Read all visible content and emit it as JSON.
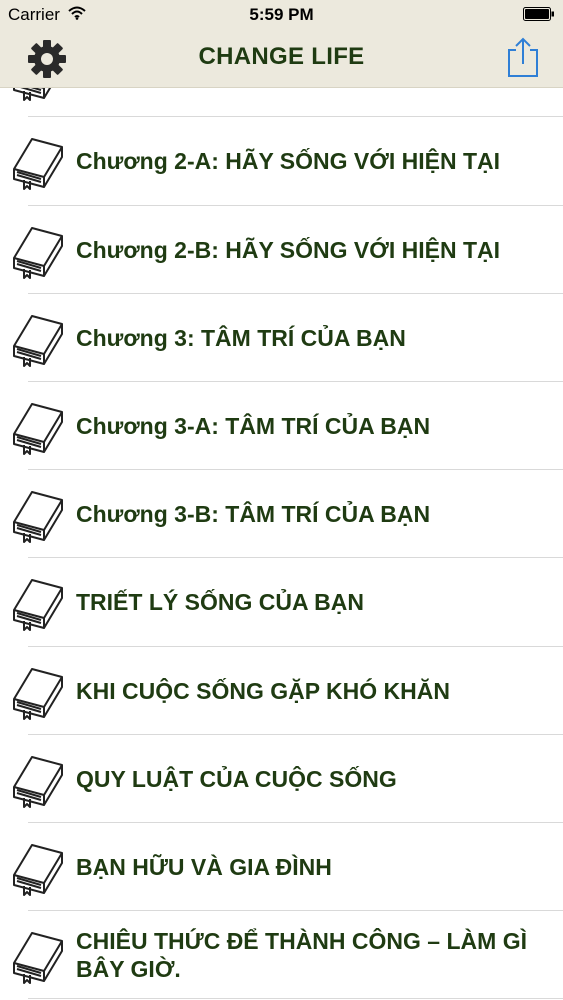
{
  "status_bar": {
    "carrier": "Carrier",
    "time": "5:59 PM"
  },
  "nav": {
    "title": "CHANGE LIFE",
    "left_icon": "gear-icon",
    "right_icon": "share-icon",
    "accent_color": "#1f3b12",
    "share_color": "#2f7fd6",
    "bar_color": "#ece9dd"
  },
  "list": {
    "item_icon": "book-icon",
    "items": [
      {
        "label": "Chương 2-A: HÃY SỐNG VỚI HIỆN TẠI"
      },
      {
        "label": "Chương 2-B: HÃY SỐNG VỚI HIỆN TẠI"
      },
      {
        "label": "Chương 3: TÂM TRÍ CỦA BẠN"
      },
      {
        "label": "Chương 3-A: TÂM TRÍ CỦA BẠN"
      },
      {
        "label": "Chương 3-B: TÂM TRÍ CỦA BẠN"
      },
      {
        "label": "TRIẾT LÝ SỐNG CỦA BẠN"
      },
      {
        "label": "KHI CUỘC SỐNG GẶP KHÓ KHĂN"
      },
      {
        "label": "QUY LUẬT CỦA CUỘC SỐNG"
      },
      {
        "label": "BẠN HỮU VÀ GIA ĐÌNH"
      },
      {
        "label": "CHIÊU THỨC ĐỂ THÀNH CÔNG – LÀM GÌ BÂY GIỜ."
      }
    ]
  }
}
